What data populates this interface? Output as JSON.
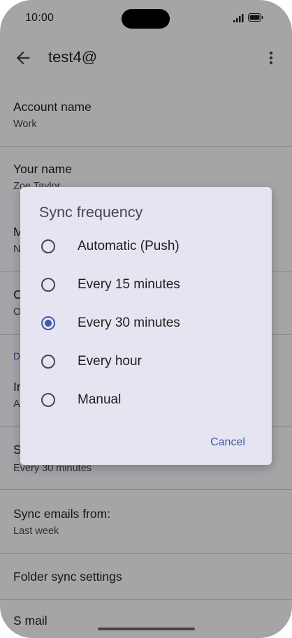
{
  "status": {
    "time": "10:00"
  },
  "appbar": {
    "title": "test4@"
  },
  "settings": {
    "account_name": {
      "label": "Account name",
      "value": "Work"
    },
    "your_name": {
      "label": "Your name",
      "value": "Zoe Taylor"
    },
    "row3": {
      "label": "M",
      "value": "N"
    },
    "row4": {
      "label": "C",
      "value": "O"
    },
    "section_header": "D",
    "row5": {
      "label": "In",
      "value": "A"
    },
    "sync_frequency": {
      "label": "S",
      "value": "Every 30 minutes"
    },
    "sync_emails_from": {
      "label": "Sync emails from:",
      "value": "Last week"
    },
    "folder_sync": {
      "label": "Folder sync settings"
    },
    "next_partial": {
      "label": "S    mail"
    }
  },
  "dialog": {
    "title": "Sync frequency",
    "options": [
      {
        "label": "Automatic (Push)",
        "selected": false
      },
      {
        "label": "Every 15 minutes",
        "selected": false
      },
      {
        "label": "Every 30 minutes",
        "selected": true
      },
      {
        "label": "Every hour",
        "selected": false
      },
      {
        "label": "Manual",
        "selected": false
      }
    ],
    "cancel_label": "Cancel"
  },
  "colors": {
    "accent": "#3f5aa8",
    "dialog_bg": "#e5e4f0",
    "scrim": "rgba(0,0,0,0.33)"
  }
}
